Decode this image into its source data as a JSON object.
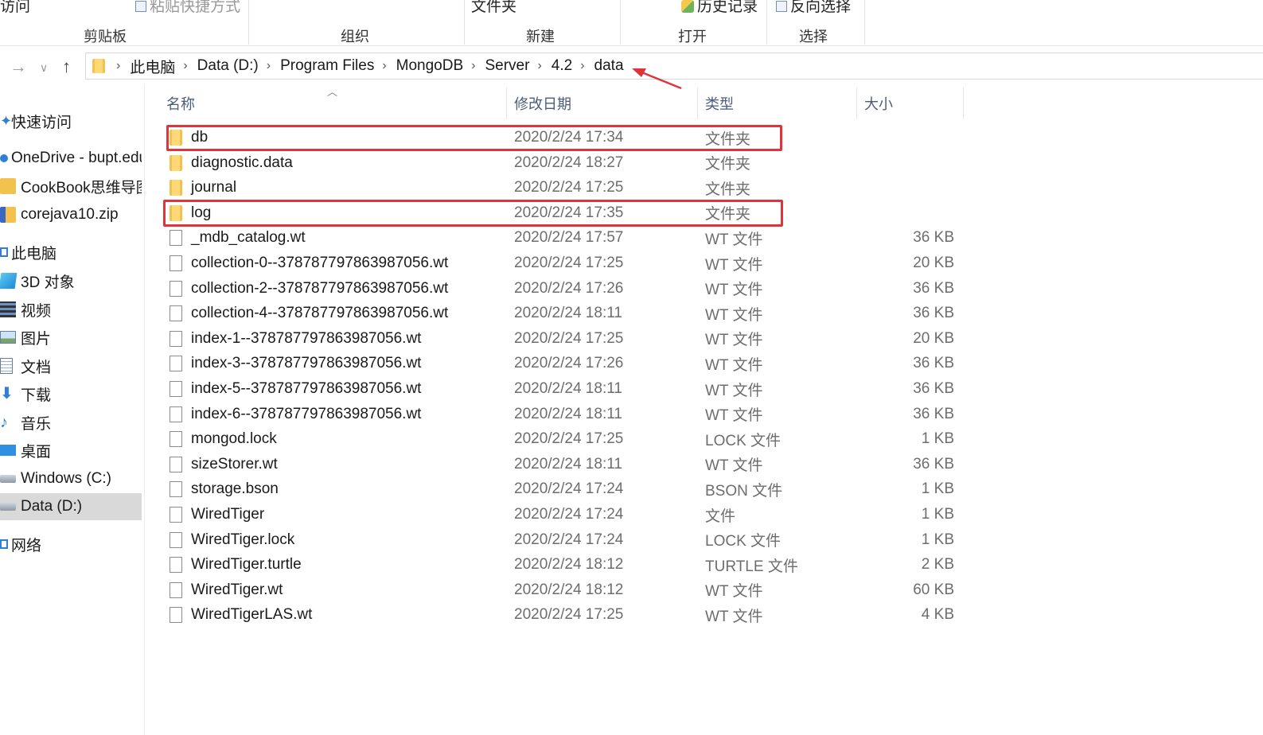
{
  "ribbon": {
    "top_items": [
      "访问",
      "粘贴快捷方式",
      "文件夹",
      "历史记录",
      "反向选择"
    ],
    "groups": [
      "剪贴板",
      "组织",
      "新建",
      "打开",
      "选择"
    ]
  },
  "address": {
    "crumbs": [
      "此电脑",
      "Data (D:)",
      "Program Files",
      "MongoDB",
      "Server",
      "4.2",
      "data"
    ]
  },
  "sidebar": {
    "items": [
      {
        "label": "快速访问",
        "icon": "star-icon"
      },
      {
        "label": "OneDrive - bupt.edu",
        "icon": "cloud-icon"
      },
      {
        "label": "CookBook思维导图",
        "icon": "folder-icon"
      },
      {
        "label": "corejava10.zip",
        "icon": "zip-icon"
      },
      {
        "label": "此电脑",
        "icon": "computer-icon"
      },
      {
        "label": "3D 对象",
        "icon": "cube-icon"
      },
      {
        "label": "视频",
        "icon": "video-icon"
      },
      {
        "label": "图片",
        "icon": "picture-icon"
      },
      {
        "label": "文档",
        "icon": "document-icon"
      },
      {
        "label": "下载",
        "icon": "download-icon"
      },
      {
        "label": "音乐",
        "icon": "music-icon"
      },
      {
        "label": "桌面",
        "icon": "desktop-icon"
      },
      {
        "label": "Windows (C:)",
        "icon": "drive-icon"
      },
      {
        "label": "Data (D:)",
        "icon": "drive-icon"
      },
      {
        "label": "网络",
        "icon": "network-icon"
      }
    ],
    "selected": "Data (D:)"
  },
  "columns": {
    "name": "名称",
    "date": "修改日期",
    "type": "类型",
    "size": "大小"
  },
  "files": [
    {
      "name": "db",
      "date": "2020/2/24 17:34",
      "type": "文件夹",
      "size": "",
      "kind": "folder",
      "highlighted": true
    },
    {
      "name": "diagnostic.data",
      "date": "2020/2/24 18:27",
      "type": "文件夹",
      "size": "",
      "kind": "folder",
      "highlighted": false
    },
    {
      "name": "journal",
      "date": "2020/2/24 17:25",
      "type": "文件夹",
      "size": "",
      "kind": "folder",
      "highlighted": false
    },
    {
      "name": "log",
      "date": "2020/2/24 17:35",
      "type": "文件夹",
      "size": "",
      "kind": "folder",
      "highlighted": true
    },
    {
      "name": "_mdb_catalog.wt",
      "date": "2020/2/24 17:57",
      "type": "WT 文件",
      "size": "36 KB",
      "kind": "file",
      "highlighted": false
    },
    {
      "name": "collection-0--378787797863987056.wt",
      "date": "2020/2/24 17:25",
      "type": "WT 文件",
      "size": "20 KB",
      "kind": "file",
      "highlighted": false
    },
    {
      "name": "collection-2--378787797863987056.wt",
      "date": "2020/2/24 17:26",
      "type": "WT 文件",
      "size": "36 KB",
      "kind": "file",
      "highlighted": false
    },
    {
      "name": "collection-4--378787797863987056.wt",
      "date": "2020/2/24 18:11",
      "type": "WT 文件",
      "size": "36 KB",
      "kind": "file",
      "highlighted": false
    },
    {
      "name": "index-1--378787797863987056.wt",
      "date": "2020/2/24 17:25",
      "type": "WT 文件",
      "size": "20 KB",
      "kind": "file",
      "highlighted": false
    },
    {
      "name": "index-3--378787797863987056.wt",
      "date": "2020/2/24 17:26",
      "type": "WT 文件",
      "size": "36 KB",
      "kind": "file",
      "highlighted": false
    },
    {
      "name": "index-5--378787797863987056.wt",
      "date": "2020/2/24 18:11",
      "type": "WT 文件",
      "size": "36 KB",
      "kind": "file",
      "highlighted": false
    },
    {
      "name": "index-6--378787797863987056.wt",
      "date": "2020/2/24 18:11",
      "type": "WT 文件",
      "size": "36 KB",
      "kind": "file",
      "highlighted": false
    },
    {
      "name": "mongod.lock",
      "date": "2020/2/24 17:25",
      "type": "LOCK 文件",
      "size": "1 KB",
      "kind": "file",
      "highlighted": false
    },
    {
      "name": "sizeStorer.wt",
      "date": "2020/2/24 18:11",
      "type": "WT 文件",
      "size": "36 KB",
      "kind": "file",
      "highlighted": false
    },
    {
      "name": "storage.bson",
      "date": "2020/2/24 17:24",
      "type": "BSON 文件",
      "size": "1 KB",
      "kind": "file",
      "highlighted": false
    },
    {
      "name": "WiredTiger",
      "date": "2020/2/24 17:24",
      "type": "文件",
      "size": "1 KB",
      "kind": "file",
      "highlighted": false
    },
    {
      "name": "WiredTiger.lock",
      "date": "2020/2/24 17:24",
      "type": "LOCK 文件",
      "size": "1 KB",
      "kind": "file",
      "highlighted": false
    },
    {
      "name": "WiredTiger.turtle",
      "date": "2020/2/24 18:12",
      "type": "TURTLE 文件",
      "size": "2 KB",
      "kind": "file",
      "highlighted": false
    },
    {
      "name": "WiredTiger.wt",
      "date": "2020/2/24 18:12",
      "type": "WT 文件",
      "size": "60 KB",
      "kind": "file",
      "highlighted": false
    },
    {
      "name": "WiredTigerLAS.wt",
      "date": "2020/2/24 17:25",
      "type": "WT 文件",
      "size": "4 KB",
      "kind": "file",
      "highlighted": false
    }
  ],
  "colors": {
    "annotation": "#e0333a",
    "header_text": "#4d5c7a",
    "folder": "#f2c14e",
    "selected_bg": "#d9d9d9"
  }
}
